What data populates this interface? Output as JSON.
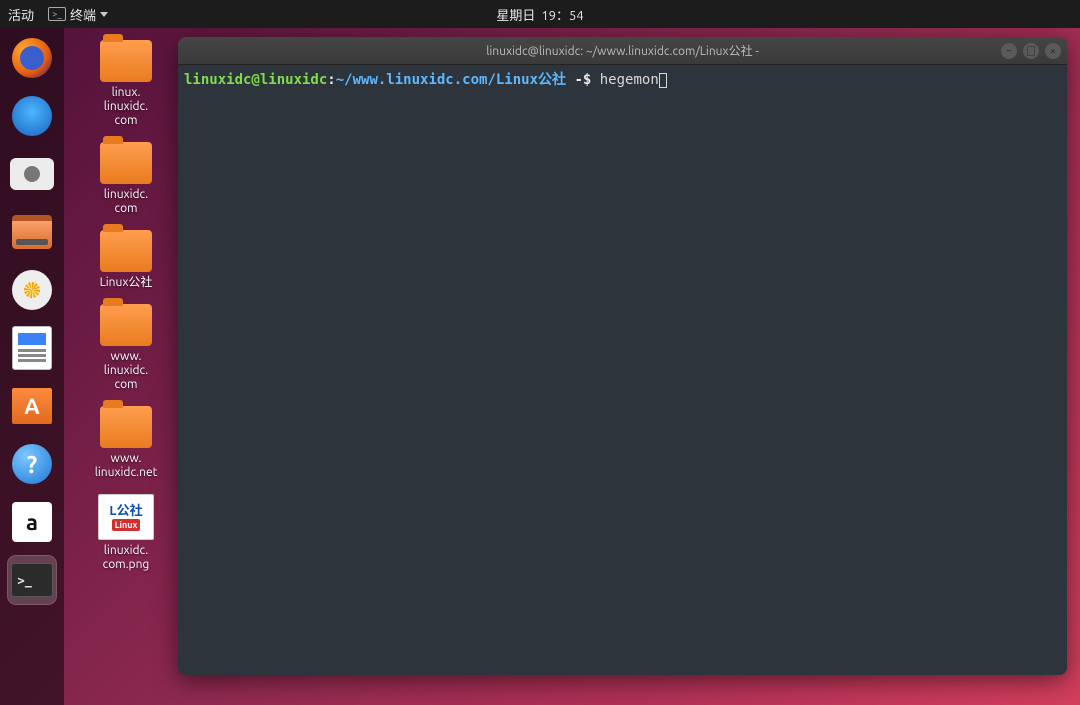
{
  "topbar": {
    "activities": "活动",
    "app_name": "终端",
    "clock_day": "星期日",
    "clock_time": "19：54"
  },
  "dock": {
    "items": [
      {
        "name": "firefox"
      },
      {
        "name": "thunderbird"
      },
      {
        "name": "camera"
      },
      {
        "name": "files"
      },
      {
        "name": "disks"
      },
      {
        "name": "writer"
      },
      {
        "name": "software"
      },
      {
        "name": "help"
      },
      {
        "name": "amazon"
      },
      {
        "name": "terminal",
        "active": true
      }
    ],
    "amazon_glyph": "a",
    "software_glyph": "A",
    "help_glyph": "?",
    "terminal_glyph": ">_"
  },
  "desktop": {
    "icons": [
      {
        "label": "linux.\nlinuxidc.\ncom",
        "type": "folder"
      },
      {
        "label": "linuxidc.\ncom",
        "type": "folder"
      },
      {
        "label": "Linux公社",
        "type": "folder"
      },
      {
        "label": "www.\nlinuxidc.\ncom",
        "type": "folder"
      },
      {
        "label": "www.\nlinuxidc.net",
        "type": "folder"
      },
      {
        "label": "linuxidc.\ncom.png",
        "type": "image"
      }
    ],
    "image_text_top": "L公社",
    "image_text_mid": "Linux"
  },
  "terminal": {
    "title": "linuxidc@linuxidc: ~/www.linuxidc.com/Linux公社 -",
    "prompt": {
      "user_host": "linuxidc@linuxidc",
      "sep": ":",
      "path": "~/www.linuxidc.com/Linux公社",
      "suffix": " -$ ",
      "command": "hegemon"
    }
  }
}
